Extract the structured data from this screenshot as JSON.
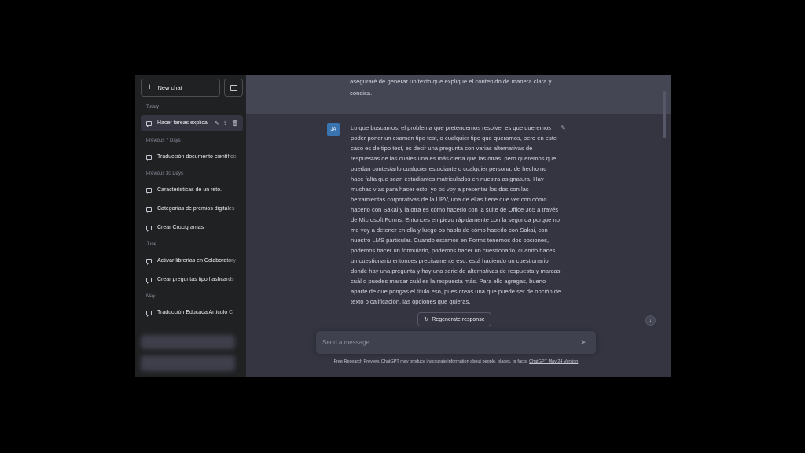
{
  "sidebar": {
    "new_chat_label": "New chat",
    "sections": {
      "today": "Today",
      "prev7": "Previous 7 Days",
      "prev30": "Previous 30 Days",
      "june": "June",
      "may": "May"
    },
    "items": [
      {
        "label": "Hacer tareas explica"
      },
      {
        "label": "Traducción documento científico"
      },
      {
        "label": "Características de un reto."
      },
      {
        "label": "Categorías de premios digitales"
      },
      {
        "label": "Crear Crucigramas"
      },
      {
        "label": "Activar librerías en Colaboratory"
      },
      {
        "label": "Crear preguntas tipo flashcards"
      },
      {
        "label": "Traducción Educada Artículo C"
      }
    ]
  },
  "conversation": {
    "previous_reply": "aseguraré de generar un texto que explique el contenido de manera clara y concisa.",
    "user_avatar": "JA",
    "user_message": "Lo que buscamos, el problema que pretendemos resolver es que queremos poder poner un examen tipo test, o cualquier tipo que queramos, pero en este caso es de tipo test, es decir una pregunta con varias alternativas de respuestas de las cuales una es más cierta que las otras, pero queremos que puedan contestarlo cualquier estudiante o cualquier persona, de hecho no hace falta que sean estudiantes matriculados en nuestra asignatura. Hay muchas vías para hacer esto, yo os voy a presentar los dos con las herramientas corporativas de la UPV, una de ellas tiene que ver con cómo hacerlo con Sakai y la otra es cómo hacerlo con la suite de Office 365 a través de Microsoft Forms. Entonces empiezo rápidamente con la segunda porque no me voy a detener en ella y luego os hablo de cómo hacerlo con Sakai, con nuestro LMS particular. Cuando estamos en Forms tenemos dos opciones, podemos hacer un formulario, podemos hacer un cuestionario, cuando haces un cuestionario entonces precisamente eso, está haciendo un cuestionario donde hay una pregunta y hay una serie de alternativas de respuesta y marcas cuál o puedes marcar cuál es la respuesta más. Para ello agregas, bueno aparte de que pongas el título eso, pues creas una que puede ser de opción de texto o calificación, las opciones que quieras."
  },
  "composer": {
    "regenerate_label": "Regenerate response",
    "placeholder": "Send a message",
    "disclaimer_text": "Free Research Preview. ChatGPT may produce inaccurate information about people, places, or facts.",
    "version_link": "ChatGPT May 24 Version"
  },
  "icons": {
    "new_chat": "plus-icon",
    "sidebar_toggle": "sidebar-toggle-icon",
    "chat": "chat-bubble-icon",
    "edit": "pencil-icon",
    "share": "share-icon",
    "delete": "trash-icon",
    "send": "send-icon",
    "regenerate": "refresh-icon",
    "scroll": "arrow-down-icon"
  },
  "colors": {
    "sidebar_bg": "#202123",
    "main_bg": "#343541",
    "assistant_bg": "#444654",
    "avatar_bg": "#3a74b0"
  }
}
